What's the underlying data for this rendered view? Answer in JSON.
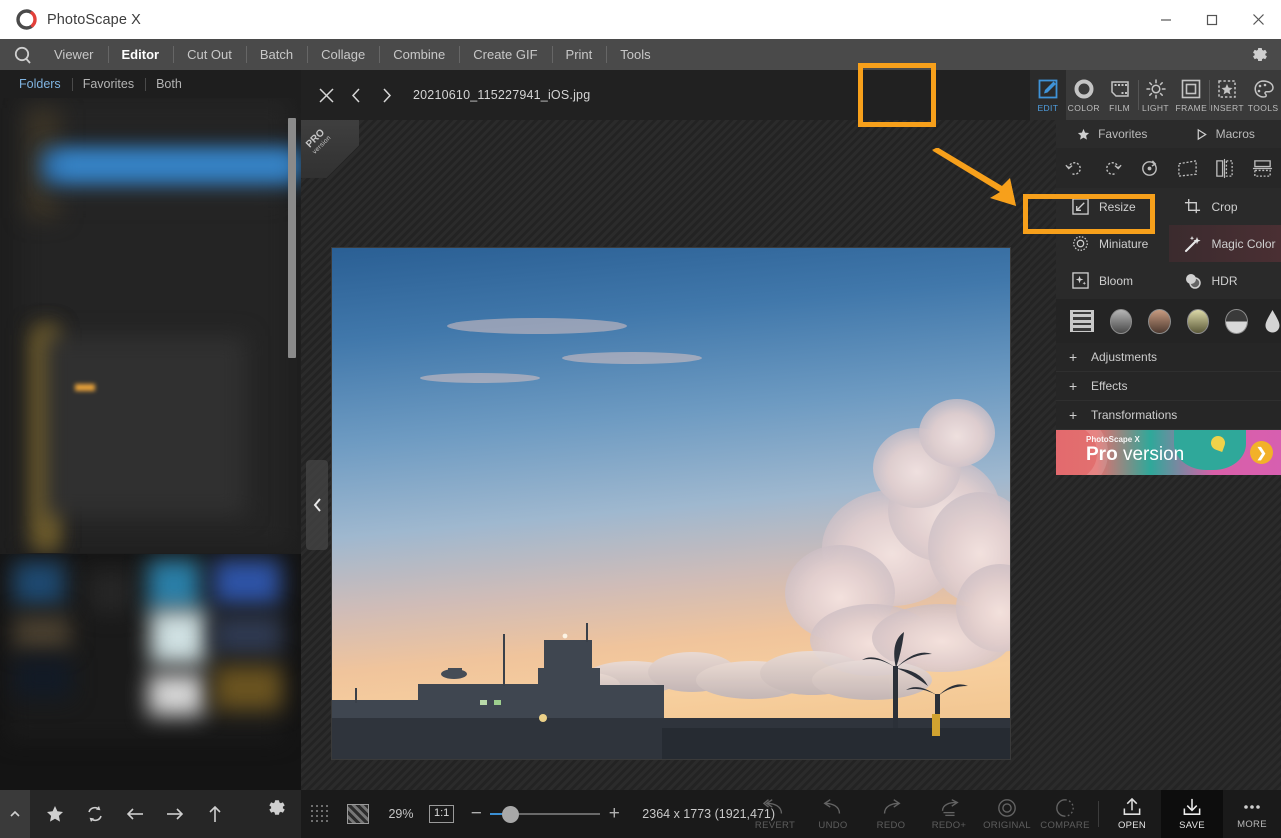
{
  "window": {
    "title": "PhotoScape X",
    "controls": {
      "minimize": "minimize-icon",
      "maximize": "maximize-icon",
      "close": "close-icon"
    }
  },
  "menubar": {
    "items": [
      {
        "label": "Viewer",
        "active": false
      },
      {
        "label": "Editor",
        "active": true
      },
      {
        "label": "Cut Out",
        "active": false
      },
      {
        "label": "Batch",
        "active": false
      },
      {
        "label": "Collage",
        "active": false
      },
      {
        "label": "Combine",
        "active": false
      },
      {
        "label": "Create GIF",
        "active": false
      },
      {
        "label": "Print",
        "active": false
      },
      {
        "label": "Tools",
        "active": false
      }
    ],
    "settings_icon": "gear-icon"
  },
  "sidebar": {
    "tabs": [
      {
        "label": "Folders",
        "active": true
      },
      {
        "label": "Favorites",
        "active": false
      },
      {
        "label": "Both",
        "active": false
      }
    ],
    "bottom_icons": [
      "collapse-caret-icon",
      "favorite-star-icon",
      "refresh-icon",
      "back-arrow-icon",
      "forward-arrow-icon",
      "up-arrow-icon",
      "gear-icon"
    ]
  },
  "file_header": {
    "close_icon": "close-icon",
    "prev_icon": "previous-image-icon",
    "next_icon": "next-image-icon",
    "filename": "20210610_115227941_iOS.jpg"
  },
  "canvas": {
    "pro_ribbon": {
      "line1": "PRO",
      "line2": "version"
    },
    "collapse_icon": "chevron-left-icon"
  },
  "statusbar": {
    "transparency_icon": "transparency-grid-icon",
    "checker_icon": "checkerboard-icon",
    "zoom_percent": "29%",
    "one_to_one": "1:1",
    "zoom_out": "−",
    "zoom_in": "+",
    "dimensions": "2364 x 1773 (1921,471)",
    "actions": [
      {
        "label": "REVERT",
        "icon": "revert-icon",
        "enabled": false
      },
      {
        "label": "UNDO",
        "icon": "undo-icon",
        "enabled": false
      },
      {
        "label": "REDO",
        "icon": "redo-icon",
        "enabled": false
      },
      {
        "label": "REDO+",
        "icon": "redo-plus-icon",
        "enabled": false
      },
      {
        "label": "ORIGINAL",
        "icon": "original-icon",
        "enabled": false
      },
      {
        "label": "COMPARE",
        "icon": "compare-icon",
        "enabled": false
      },
      {
        "label": "OPEN",
        "icon": "open-icon",
        "enabled": true
      },
      {
        "label": "SAVE",
        "icon": "save-icon",
        "enabled": true
      },
      {
        "label": "MORE",
        "icon": "more-icon",
        "enabled": true
      }
    ]
  },
  "right_panel": {
    "tools": [
      {
        "label": "EDIT",
        "icon": "edit-pencil-icon",
        "active": true
      },
      {
        "label": "COLOR",
        "icon": "color-ring-icon",
        "active": false
      },
      {
        "label": "FILM",
        "icon": "film-icon",
        "active": false
      },
      {
        "label": "LIGHT",
        "icon": "light-sun-icon",
        "active": false
      },
      {
        "label": "FRAME",
        "icon": "frame-icon",
        "active": false
      },
      {
        "label": "INSERT",
        "icon": "insert-star-icon",
        "active": false
      },
      {
        "label": "TOOLS",
        "icon": "tools-palette-icon",
        "active": false
      }
    ],
    "subtabs": [
      {
        "label": "Favorites",
        "icon": "star-icon"
      },
      {
        "label": "Macros",
        "icon": "play-triangle-icon"
      }
    ],
    "rotate_icons": [
      "rotate-left-icon",
      "rotate-right-icon",
      "free-rotate-icon",
      "perspective-icon",
      "flip-horizontal-icon",
      "flip-vertical-icon"
    ],
    "actions": [
      {
        "label": "Resize",
        "icon": "resize-icon",
        "highlighted": true
      },
      {
        "label": "Crop",
        "icon": "crop-icon",
        "highlighted": false
      },
      {
        "label": "Miniature",
        "icon": "miniature-icon",
        "highlighted": false
      },
      {
        "label": "Magic Color",
        "icon": "magic-wand-icon",
        "highlighted": false
      },
      {
        "label": "Bloom",
        "icon": "bloom-icon",
        "highlighted": false
      },
      {
        "label": "HDR",
        "icon": "hdr-icon",
        "highlighted": false
      }
    ],
    "filters": [
      {
        "name": "filter-list-icon",
        "color": "#c9c9c9"
      },
      {
        "name": "filter-gray-icon",
        "color": "#9a9a9a"
      },
      {
        "name": "filter-sepia-icon",
        "color": "#a8806a"
      },
      {
        "name": "filter-olive-icon",
        "color": "#c9c59a"
      },
      {
        "name": "filter-split-icon",
        "color": "#3a3a3a"
      },
      {
        "name": "filter-drop-icon",
        "color": "#d4d4d4"
      }
    ],
    "accordions": [
      {
        "label": "Adjustments",
        "expand": "+"
      },
      {
        "label": "Effects",
        "expand": "+"
      },
      {
        "label": "Transformations",
        "expand": "+"
      }
    ],
    "promo": {
      "brand": "PhotoScape X",
      "title_bold": "Pro",
      "title_rest": " version",
      "arrow": "❯"
    }
  },
  "annotations": {
    "accent_color": "#f7a01b",
    "highlight_edit": "edit-tool-highlight-box",
    "highlight_resize": "resize-button-highlight-box",
    "arrow": "pointer-arrow-to-resize"
  }
}
